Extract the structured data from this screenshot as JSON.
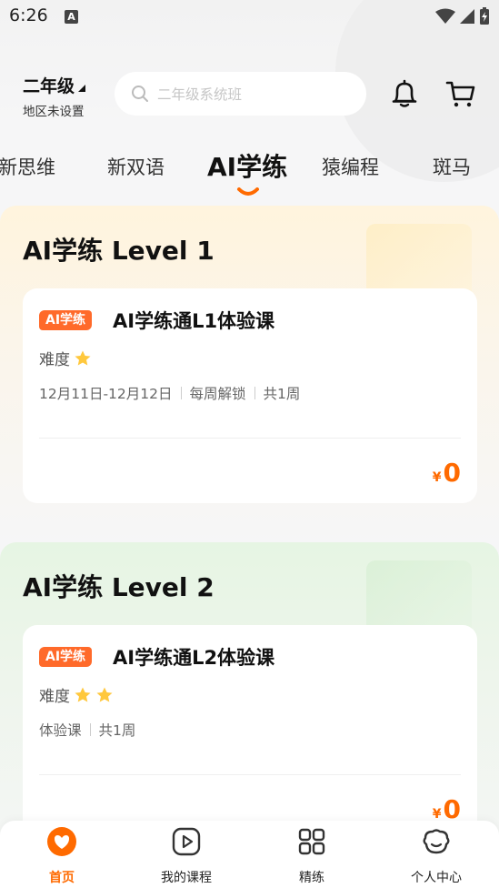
{
  "status_bar": {
    "time": "6:26",
    "notification_letter": "A"
  },
  "header": {
    "grade": "二年级",
    "region": "地区未设置",
    "search_placeholder": "二年级系统班"
  },
  "tabs": [
    {
      "label": "新思维"
    },
    {
      "label": "新双语"
    },
    {
      "label": "AI学练"
    },
    {
      "label": "猿编程"
    },
    {
      "label": "斑马"
    }
  ],
  "active_tab": "AI学练",
  "sections": [
    {
      "title": "AI学练 Level 1",
      "card": {
        "badge": "AI学练",
        "title": "AI学练通L1体验课",
        "difficulty_label": "难度",
        "difficulty_stars": 1,
        "meta": [
          "12月11日-12月12日",
          "每周解锁",
          "共1周"
        ],
        "price_symbol": "¥",
        "price": "0"
      }
    },
    {
      "title": "AI学练 Level 2",
      "card": {
        "badge": "AI学练",
        "title": "AI学练通L2体验课",
        "difficulty_label": "难度",
        "difficulty_stars": 2,
        "meta": [
          "体验课",
          "共1周"
        ],
        "price_symbol": "¥",
        "price": "0"
      }
    }
  ],
  "bottom_nav": [
    {
      "label": "首页",
      "icon": "home-icon",
      "active": true
    },
    {
      "label": "我的课程",
      "icon": "play-icon",
      "active": false
    },
    {
      "label": "精练",
      "icon": "grid-icon",
      "active": false
    },
    {
      "label": "个人中心",
      "icon": "profile-icon",
      "active": false
    }
  ],
  "colors": {
    "accent": "#ff6a00",
    "badge": "#ff6a2a",
    "star": "#ffc83d"
  }
}
